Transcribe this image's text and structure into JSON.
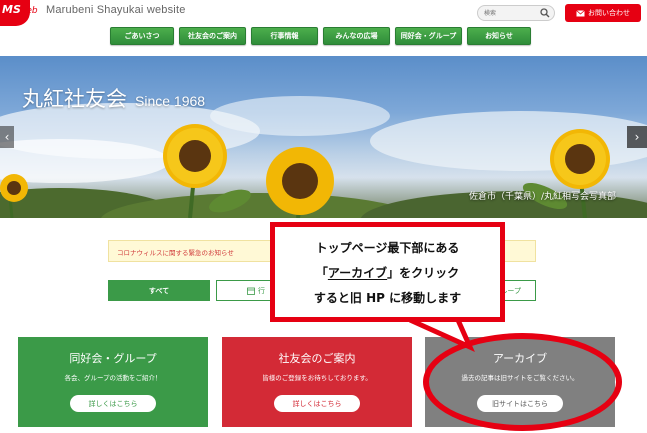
{
  "header": {
    "logo_ms": "MS",
    "logo_web": "web",
    "site_name": "Marubeni Shayukai website",
    "search_placeholder": "検索",
    "contact_label": "お問い合わせ"
  },
  "nav": {
    "items": [
      {
        "label": "ごあいさつ"
      },
      {
        "label": "社友会のご案内"
      },
      {
        "label": "行事情報"
      },
      {
        "label": "みんなの広場"
      },
      {
        "label": "同好会・グループ"
      },
      {
        "label": "お知らせ"
      }
    ]
  },
  "hero": {
    "title": "丸紅社友会",
    "since": "Since 1968",
    "caption": "佐倉市（千葉県）/丸紅相写会写真部"
  },
  "notice": {
    "text": "コロナウィルスに関する緊急のお知らせ"
  },
  "tabs": {
    "all": "すべて",
    "event_partial": "行",
    "group_partial": "ループ"
  },
  "cards": [
    {
      "title": "同好会・グループ",
      "desc": "各会、グループの活動をご紹介！",
      "button": "詳しくはこちら"
    },
    {
      "title": "社友会のご案内",
      "desc": "皆様のご登録をお待ちしております。",
      "button": "詳しくはこちら"
    },
    {
      "title": "アーカイブ",
      "desc": "過去の記事は旧サイトをご覧ください。",
      "button": "旧サイトはこちら"
    }
  ],
  "callout": {
    "line1": "トップページ最下部にある",
    "line2_pre": "「",
    "line2_link": "アーカイブ",
    "line2_post": "」をクリック",
    "line3": "すると旧 HP に移動します"
  },
  "colors": {
    "brand_red": "#e60012",
    "nav_green": "#3b9a48",
    "card_red": "#d32a36",
    "card_gray": "#808080"
  }
}
